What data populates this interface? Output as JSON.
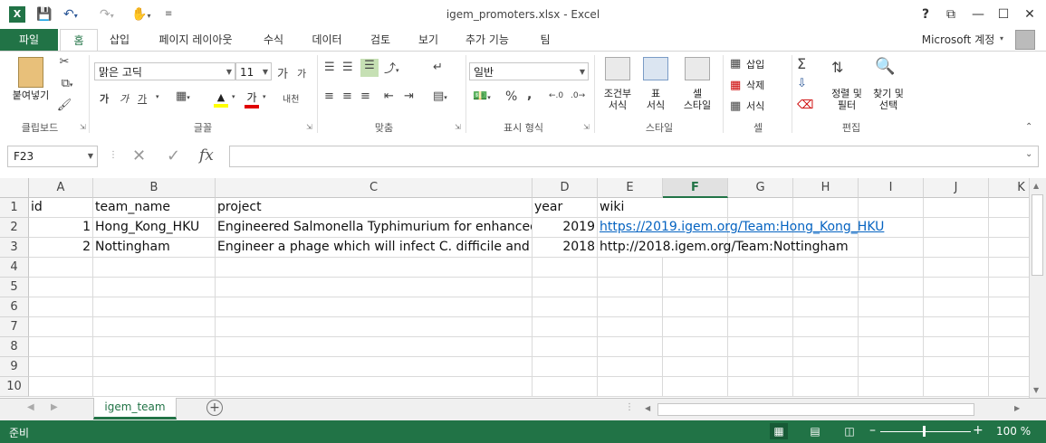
{
  "window": {
    "title": "igem_promoters.xlsx - Excel",
    "buttons": {
      "help": "?",
      "ribbon_display": "⧉",
      "minimize": "—",
      "maximize": "☐",
      "close": "✕"
    }
  },
  "tabs": {
    "file": "파일",
    "home": "홈",
    "insert": "삽입",
    "page_layout": "페이지 레이아웃",
    "formulas": "수식",
    "data": "데이터",
    "review": "검토",
    "view": "보기",
    "addins": "추가 기능",
    "team": "팀",
    "account": "Microsoft 계정"
  },
  "ribbon": {
    "clipboard": {
      "paste": "붙여넣기",
      "label": "클립보드"
    },
    "font": {
      "name": "맑은 고딕",
      "size": "11",
      "bold": "가",
      "italic": "가",
      "underline": "가",
      "label": "글꼴",
      "grow": "가",
      "shrink": "가",
      "font_color_glyph": "가",
      "phonetic": "내천"
    },
    "alignment": {
      "label": "맞춤"
    },
    "number": {
      "format": "일반",
      "percent": "%",
      "comma": ",",
      "label": "표시 형식"
    },
    "styles": {
      "conditional": "조건부\n서식",
      "table": "표\n서식",
      "cell_styles": "셀\n스타일",
      "label": "스타일"
    },
    "cells": {
      "insert": "삽입",
      "delete": "삭제",
      "format": "서식",
      "label": "셀"
    },
    "editing": {
      "sort_filter": "정렬 및\n필터",
      "find_select": "찾기 및\n선택",
      "label": "편집"
    }
  },
  "formula_bar": {
    "name_box": "F23",
    "fx": "fx",
    "value": ""
  },
  "grid": {
    "columns": [
      "A",
      "B",
      "C",
      "D",
      "E",
      "F",
      "G",
      "H",
      "I",
      "J",
      "K"
    ],
    "selected_column": "F",
    "row_numbers": [
      "1",
      "2",
      "3",
      "4",
      "5",
      "6",
      "7",
      "8",
      "9",
      "10"
    ],
    "rows": [
      {
        "A": "id",
        "B": "team_name",
        "C": "project",
        "D": "year",
        "E": "wiki"
      },
      {
        "A": "1",
        "B": "Hong_Kong_HKU",
        "C": "Engineered Salmonella Typhimurium for enhanced",
        "D": "2019",
        "E": "https://2019.igem.org/Team:Hong_Kong_HKU"
      },
      {
        "A": "2",
        "B": "Nottingham",
        "C": "Engineer a phage which will infect C. difficile and d",
        "D": "2018",
        "E": "http://2018.igem.org/Team:Nottingham"
      }
    ]
  },
  "sheets": {
    "active": "igem_team",
    "add": "+"
  },
  "status": {
    "ready": "준비",
    "zoom": "100 %"
  },
  "colors": {
    "accent": "#217346",
    "link": "#0563c1"
  }
}
